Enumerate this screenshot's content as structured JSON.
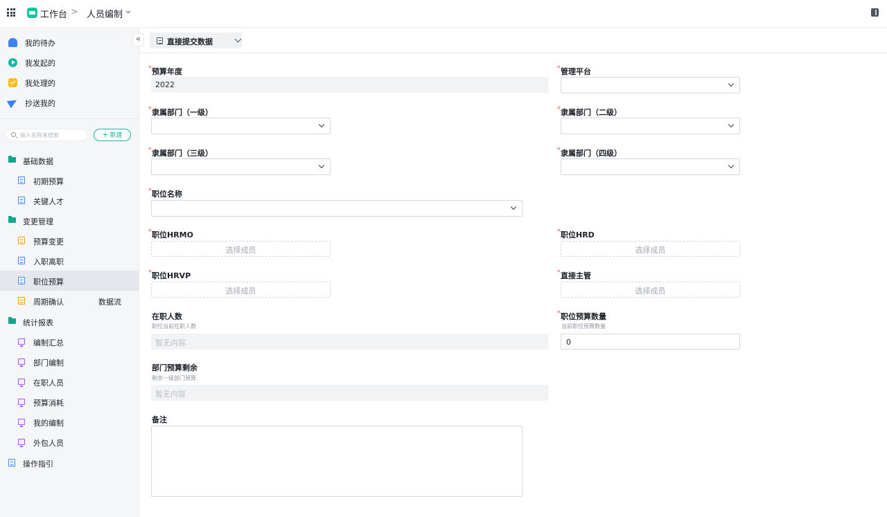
{
  "topbar": {
    "app_name": "工作台",
    "separator": ">",
    "page_title": "人员编制"
  },
  "sidebar": {
    "quick_items": [
      {
        "label": "我的待办",
        "icon": "bell-icon"
      },
      {
        "label": "我发起的",
        "icon": "play-icon"
      },
      {
        "label": "我处理的",
        "icon": "check-icon"
      },
      {
        "label": "抄送我的",
        "icon": "send-icon"
      }
    ],
    "search": {
      "placeholder": "输入名称来搜索"
    },
    "new_button": {
      "icon": "+",
      "label": "新建"
    },
    "collapse_icon": "«",
    "groups": {
      "basic": {
        "label": "基础数据",
        "items": [
          {
            "label": "初期预算",
            "icon": "doc-blue-icon"
          },
          {
            "label": "关键人才",
            "icon": "doc-blue-icon"
          }
        ]
      },
      "change": {
        "label": "变更管理",
        "items": [
          {
            "label": "预算变更",
            "icon": "doc-orange-icon"
          },
          {
            "label": "入职离职",
            "icon": "doc-blue-icon"
          },
          {
            "label": "职位预算",
            "icon": "doc-blue-icon",
            "active": true
          },
          {
            "label": "周期确认",
            "icon": "doc-orange-icon",
            "extra": "数据流"
          }
        ]
      },
      "reports": {
        "label": "统计报表",
        "items": [
          {
            "label": "编制汇总",
            "icon": "monitor-icon"
          },
          {
            "label": "部门编制",
            "icon": "monitor-icon"
          },
          {
            "label": "在职人员",
            "icon": "monitor-icon"
          },
          {
            "label": "预算消耗",
            "icon": "monitor-icon"
          },
          {
            "label": "我的编制",
            "icon": "monitor-icon"
          },
          {
            "label": "外包人员",
            "icon": "monitor-icon"
          }
        ]
      }
    },
    "guide": {
      "label": "操作指引"
    }
  },
  "form": {
    "submit_mode": {
      "label": "直接提交数据"
    },
    "required_mark": "*",
    "fields": {
      "budget_year": {
        "label": "预算年度",
        "value": "2022"
      },
      "platform": {
        "label": "管理平台",
        "value": ""
      },
      "dept_l1": {
        "label": "隶属部门（一级）",
        "value": ""
      },
      "dept_l2": {
        "label": "隶属部门（二级）",
        "value": ""
      },
      "dept_l3": {
        "label": "隶属部门（三级）",
        "value": ""
      },
      "dept_l4": {
        "label": "隶属部门（四级）",
        "value": ""
      },
      "position_name": {
        "label": "职位名称",
        "value": ""
      },
      "hrmo": {
        "label": "职位HRMO",
        "placeholder": "选择成员"
      },
      "hrd": {
        "label": "职位HRD",
        "placeholder": "选择成员"
      },
      "hrvp": {
        "label": "职位HRVP",
        "placeholder": "选择成员"
      },
      "manager": {
        "label": "直接主管",
        "placeholder": "选择成员"
      },
      "headcount": {
        "label": "在职人数",
        "hint": "职位当前在职人数",
        "value": "暂无内容"
      },
      "budget_count": {
        "label": "职位预算数量",
        "hint": "当前职位预算数量",
        "value": "0"
      },
      "dept_remaining": {
        "label": "部门预算剩余",
        "hint": "剩余一级部门预算",
        "value": "暂无内容"
      },
      "remarks": {
        "label": "备注",
        "value": ""
      }
    }
  }
}
